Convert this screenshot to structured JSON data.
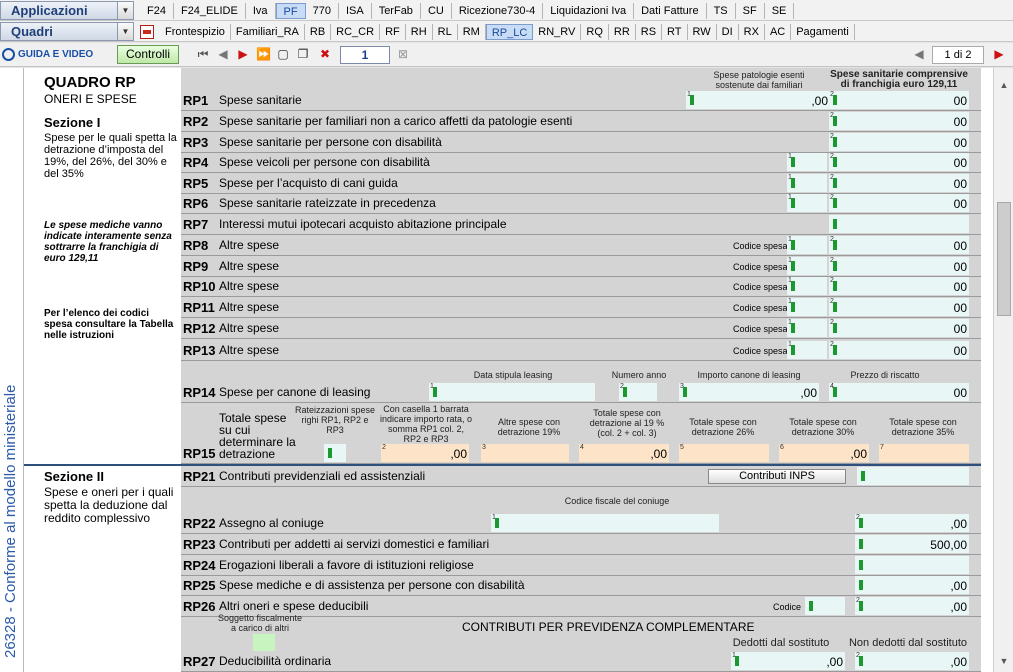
{
  "nav1": {
    "combo": "Applicazioni",
    "tabs": [
      "F24",
      "F24_ELIDE",
      "Iva",
      "PF",
      "770",
      "ISA",
      "TerFab",
      "CU",
      "Ricezione730-4",
      "Liquidazioni Iva",
      "Dati Fatture",
      "TS",
      "SF",
      "SE"
    ],
    "active": "PF"
  },
  "nav2": {
    "combo": "Quadri",
    "tabs": [
      "Frontespizio",
      "Familiari_RA",
      "RB",
      "RC_CR",
      "RF",
      "RH",
      "RL",
      "RM",
      "RP_LC",
      "RN_RV",
      "RQ",
      "RR",
      "RS",
      "RT",
      "RW",
      "DI",
      "RX",
      "AC",
      "Pagamenti"
    ],
    "active": "RP_LC"
  },
  "toolbar": {
    "guida": "GUIDA E VIDEO",
    "controlli": "Controlli",
    "page_input": "1",
    "pager": "1 di 2"
  },
  "side": {
    "vertical": "26328 - Conforme al modello ministeriale"
  },
  "left": {
    "title": "QUADRO RP",
    "subtitle": "ONERI E SPESE",
    "sez1": "Sezione I",
    "sez1_desc": "Spese per le quali spetta la detrazione d’imposta del 19%, del 26%, del 30% e del 35%",
    "note1": "Le spese mediche vanno indicate interamente senza sottrarre la franchigia di euro 129,11",
    "note2": "Per l’elenco dei codici spesa consultare la Tabella nelle istruzioni",
    "sez2": "Sezione II",
    "sez2_desc": "Spese e oneri per i quali spetta la deduzione dal reddito complessivo"
  },
  "headers": {
    "h1": "Spese patologie esenti sostenute dai familiari",
    "h2": "Spese sanitarie comprensive di franchigia euro 129,11",
    "rp14_data": "Data stipula leasing",
    "rp14_anno": "Numero anno",
    "rp14_canone": "Importo canone di leasing",
    "rp14_riscatto": "Prezzo di riscatto",
    "rp15_rate": "Rateizzazioni spese righi RP1, RP2 e RP3",
    "rp15_casella": "Con casella 1 barrata indicare importo rata, o somma RP1 col. 2, RP2 e RP3",
    "rp15_altre": "Altre spese con detrazione 19%",
    "rp15_tot19": "Totale spese con detrazione al 19 % (col. 2 + col. 3)",
    "rp15_26": "Totale spese con detrazione 26%",
    "rp15_30": "Totale spese con detrazione 30%",
    "rp15_35": "Totale spese con detrazione 35%",
    "rp22_cf": "Codice fiscale del coniuge",
    "rp27_sogg": "Soggetto fiscalmente a carico di altri",
    "rp27_title": "CONTRIBUTI PER PREVIDENZA COMPLEMENTARE",
    "rp27_dedotti": "Dedotti dal sostituto",
    "rp27_nondedotti": "Non dedotti dal sostituto",
    "codice_spesa": "Codice spesa",
    "codice": "Codice"
  },
  "rows": [
    {
      "code": "RP1",
      "label": "Spese sanitarie"
    },
    {
      "code": "RP2",
      "label": "Spese sanitarie per familiari non a carico affetti da patologie esenti"
    },
    {
      "code": "RP3",
      "label": "Spese sanitarie per persone con disabilità"
    },
    {
      "code": "RP4",
      "label": "Spese veicoli per persone con disabilità"
    },
    {
      "code": "RP5",
      "label": "Spese per l’acquisto di cani guida"
    },
    {
      "code": "RP6",
      "label": "Spese sanitarie rateizzate in precedenza"
    },
    {
      "code": "RP7",
      "label": "Interessi mutui ipotecari acquisto abitazione principale"
    },
    {
      "code": "RP8",
      "label": "Altre spese"
    },
    {
      "code": "RP9",
      "label": "Altre spese"
    },
    {
      "code": "RP10",
      "label": "Altre spese"
    },
    {
      "code": "RP11",
      "label": "Altre spese"
    },
    {
      "code": "RP12",
      "label": "Altre spese"
    },
    {
      "code": "RP13",
      "label": "Altre spese"
    },
    {
      "code": "RP14",
      "label": "Spese per canone di leasing"
    },
    {
      "code": "RP15",
      "label": "Totale spese su cui determinare la detrazione"
    },
    {
      "code": "RP21",
      "label": "Contributi previdenziali ed assistenziali"
    },
    {
      "code": "RP22",
      "label": "Assegno al coniuge"
    },
    {
      "code": "RP23",
      "label": "Contributi per addetti ai servizi domestici e familiari"
    },
    {
      "code": "RP24",
      "label": "Erogazioni liberali a favore di istituzioni religiose"
    },
    {
      "code": "RP25",
      "label": "Spese mediche e di assistenza per persone con disabilità"
    },
    {
      "code": "RP26",
      "label": "Altri oneri e spese deducibili"
    },
    {
      "code": "RP27",
      "label": "Deducibilità ordinaria"
    }
  ],
  "values": {
    "zero": ",00",
    "cents": "00",
    "rp23": "500"
  },
  "buttons": {
    "inps": "Contributi INPS"
  }
}
